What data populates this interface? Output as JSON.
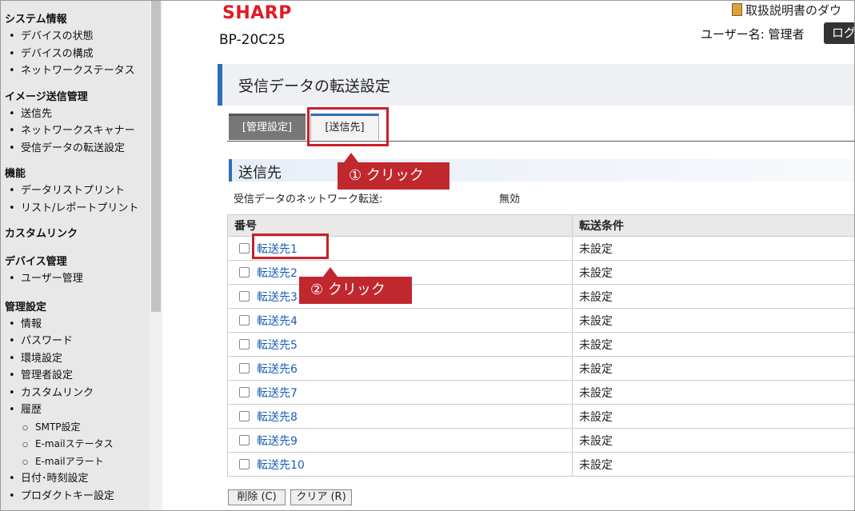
{
  "sidebar": {
    "sections": [
      {
        "heading": "システム情報",
        "items": [
          "デバイスの状態",
          "デバイスの構成",
          "ネットワークステータス"
        ]
      },
      {
        "heading": "イメージ送信管理",
        "items": [
          "送信先",
          "ネットワークスキャナー",
          "受信データの転送設定"
        ]
      },
      {
        "heading": "機能",
        "items": [
          "データリストプリント",
          "リスト/レポートプリント"
        ]
      },
      {
        "heading": "カスタムリンク",
        "items": []
      },
      {
        "heading": "デバイス管理",
        "items": [
          "ユーザー管理"
        ]
      },
      {
        "heading": "管理設定",
        "items": [
          "情報",
          "パスワード",
          "環境設定",
          "管理者設定",
          "カスタムリンク",
          "履歴"
        ],
        "subitems": [
          "SMTP設定",
          "E-mailステータス",
          "E-mailアラート"
        ],
        "after_items": [
          "日付･時刻設定",
          "プロダクトキー設定"
        ]
      }
    ]
  },
  "header": {
    "brand": "SHARP",
    "model": "BP-20C25",
    "manual_link": "取扱説明書のダウ",
    "user_label": "ユーザー名: 管理者",
    "logout_button": "ログ"
  },
  "page": {
    "title": "受信データの転送設定",
    "tabs": [
      {
        "label": "[管理設定]",
        "active": false
      },
      {
        "label": "[送信先]",
        "active": true
      }
    ],
    "section_title": "送信先",
    "forward_label": "受信データのネットワーク転送:",
    "forward_value": "無効"
  },
  "table": {
    "columns": [
      "番号",
      "転送条件"
    ],
    "rows": [
      {
        "name": "転送先1",
        "condition": "未設定"
      },
      {
        "name": "転送先2",
        "condition": "未設定"
      },
      {
        "name": "転送先3",
        "condition": "未設定"
      },
      {
        "name": "転送先4",
        "condition": "未設定"
      },
      {
        "name": "転送先5",
        "condition": "未設定"
      },
      {
        "name": "転送先6",
        "condition": "未設定"
      },
      {
        "name": "転送先7",
        "condition": "未設定"
      },
      {
        "name": "転送先8",
        "condition": "未設定"
      },
      {
        "name": "転送先9",
        "condition": "未設定"
      },
      {
        "name": "転送先10",
        "condition": "未設定"
      }
    ]
  },
  "buttons": {
    "delete": "削除 (C)",
    "clear": "クリア (R)"
  },
  "annotations": {
    "callout1": "① クリック",
    "callout2": "② クリック"
  },
  "colors": {
    "brand_red": "#e01a22",
    "accent_blue": "#2c6fb7",
    "link_blue": "#1a5db8",
    "callout_red": "#c0282e"
  },
  "icons": {
    "manual": "book-icon"
  }
}
